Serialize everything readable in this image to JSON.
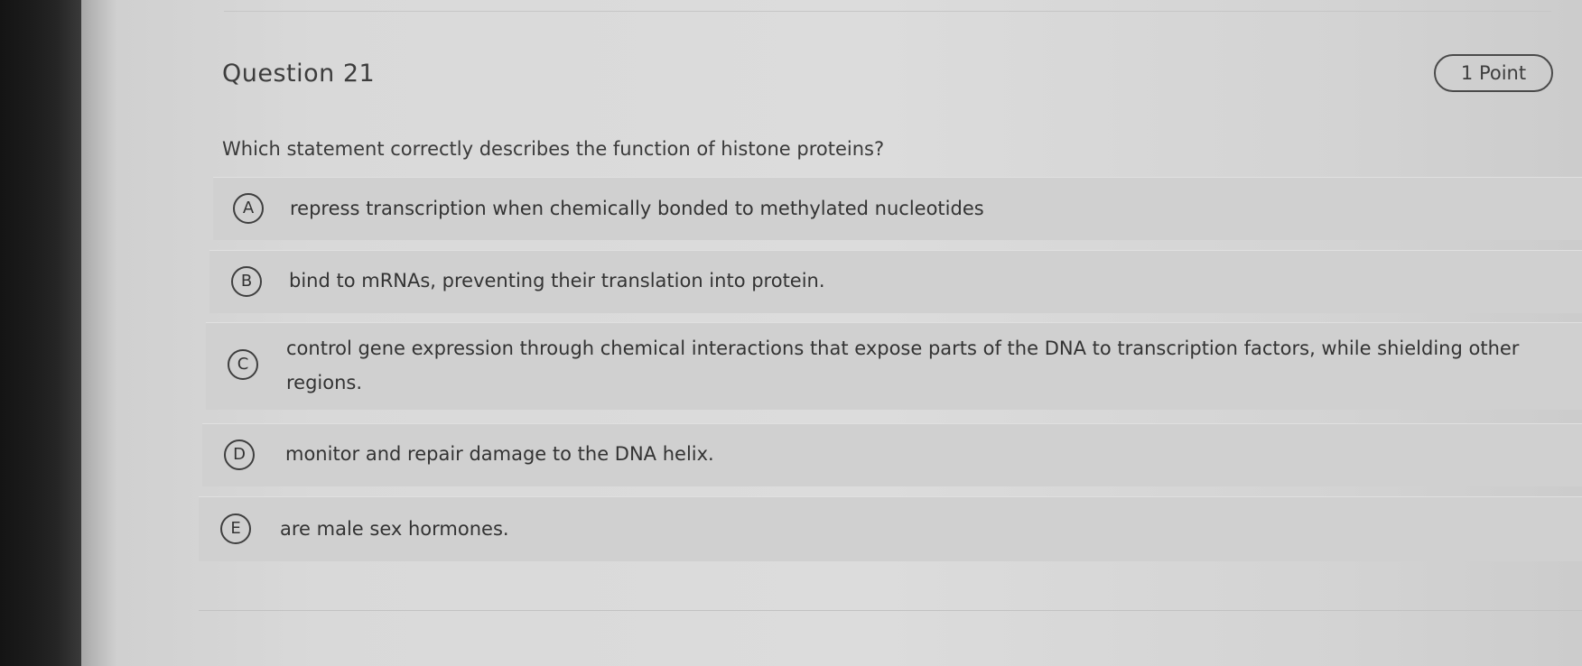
{
  "question": {
    "title": "Question 21",
    "points": "1 Point",
    "prompt": "Which statement correctly describes the function of histone proteins?"
  },
  "options": [
    {
      "letter": "A",
      "text": "repress transcription when chemically bonded to methylated nucleotides"
    },
    {
      "letter": "B",
      "text": "bind to mRNAs, preventing their translation into protein."
    },
    {
      "letter": "C",
      "text": "control gene expression through chemical interactions that expose parts of the DNA to transcription factors, while shielding other regions."
    },
    {
      "letter": "D",
      "text": "monitor and repair damage to the DNA helix."
    },
    {
      "letter": "E",
      "text": "are male sex hormones."
    }
  ]
}
